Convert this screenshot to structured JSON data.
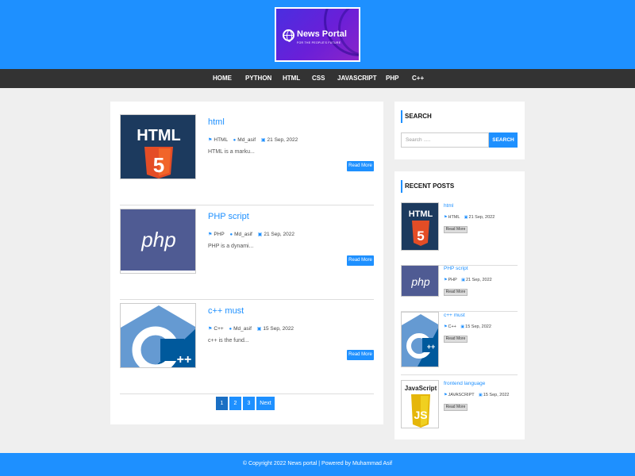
{
  "header": {
    "logo_name": "News Portal",
    "logo_tagline": "FOR THE PEOPLE'S FUTURE",
    "accent": "#1e90ff"
  },
  "nav": {
    "items": [
      "HOME",
      "PYTHON",
      "HTML",
      "CSS",
      "JAVASCRIPT",
      "PHP",
      "C++"
    ]
  },
  "posts": [
    {
      "title": "html",
      "category": "HTML",
      "author": "Md_asif",
      "date": "21 Sep, 2022",
      "excerpt": "HTML is a marku...",
      "read_more": "Read More",
      "thumb_icon": "html5-logo"
    },
    {
      "title": "PHP script",
      "category": "PHP",
      "author": "Md_asif",
      "date": "21 Sep, 2022",
      "excerpt": "PHP is a dynami...",
      "read_more": "Read More",
      "thumb_icon": "php-logo"
    },
    {
      "title": "c++ must",
      "category": "C++",
      "author": "Md_asif",
      "date": "15 Sep, 2022",
      "excerpt": "c++ is the fund...",
      "read_more": "Read More",
      "thumb_icon": "cpp-logo"
    }
  ],
  "pagination": {
    "pages": [
      "1",
      "2",
      "3"
    ],
    "current": 1,
    "next_label": "Next"
  },
  "search": {
    "title": "SEARCH",
    "placeholder": "Search .....",
    "button_label": "SEARCH"
  },
  "recent_posts": {
    "title": "RECENT POSTS",
    "items": [
      {
        "title": "html",
        "category": "HTML",
        "date": "21 Sep, 2022",
        "read_more": "Read More",
        "thumb_icon": "html5-logo"
      },
      {
        "title": "PHP script",
        "category": "PHP",
        "date": "21 Sep, 2022",
        "read_more": "Read More",
        "thumb_icon": "php-logo"
      },
      {
        "title": "c++ must",
        "category": "C++",
        "date": "15 Sep, 2022",
        "read_more": "Read More",
        "thumb_icon": "cpp-logo"
      },
      {
        "title": "frontend language",
        "category": "JAVASCRIPT",
        "date": "15 Sep, 2022",
        "read_more": "Read More",
        "thumb_icon": "javascript-logo"
      }
    ]
  },
  "footer": {
    "text": "© Copyright 2022 News portal | Powered by Muhammad Asif"
  }
}
